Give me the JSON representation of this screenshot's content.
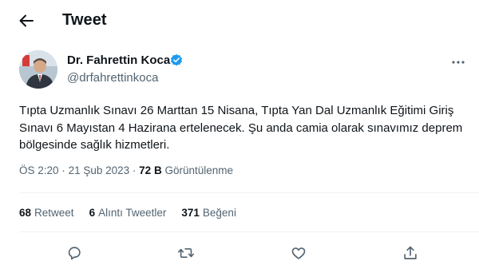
{
  "header": {
    "title": "Tweet",
    "back_icon": "arrow-left-icon"
  },
  "author": {
    "name": "Dr. Fahrettin Koca",
    "handle": "@drfahrettinkoca",
    "verified_color": "#1d9bf0"
  },
  "tweet": {
    "text": "Tıpta Uzmanlık Sınavı 26 Marttan 15 Nisana, Tıpta Yan Dal Uzmanlık Eğitimi Giriş Sınavı 6 Mayıstan 4 Hazirana ertelenecek. Şu anda camia olarak sınavımız deprem bölgesinde sağlık hizmetleri.",
    "time": "ÖS 2:20",
    "separator": "·",
    "date": "21 Şub 2023",
    "views_count": "72 B",
    "views_label": "Görüntülenme"
  },
  "stats": [
    {
      "count": "68",
      "label": "Retweet"
    },
    {
      "count": "6",
      "label": "Alıntı Tweetler"
    },
    {
      "count": "371",
      "label": "Beğeni"
    }
  ],
  "actions": [
    "reply-icon",
    "retweet-icon",
    "like-icon",
    "share-icon"
  ],
  "colors": {
    "text": "#0f1419",
    "secondary": "#536471",
    "divider": "#eff3f4",
    "accent": "#1d9bf0"
  }
}
